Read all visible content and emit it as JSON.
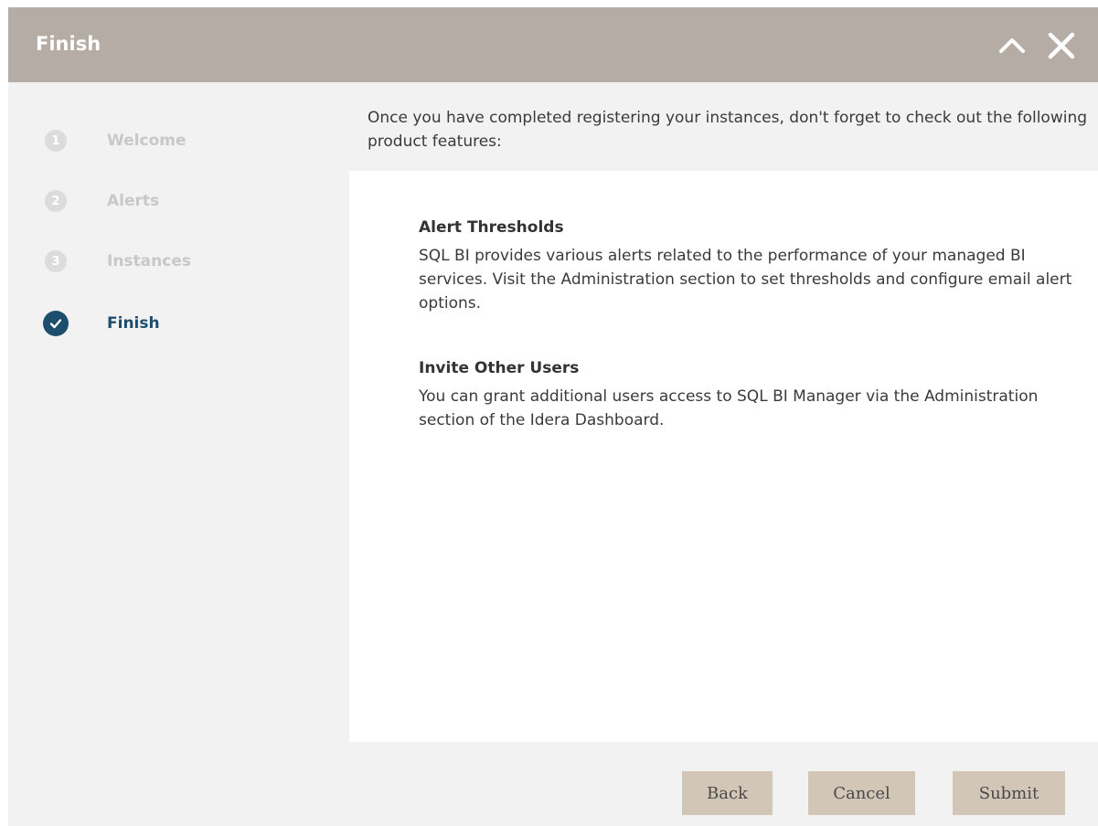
{
  "dialog": {
    "title": "Finish"
  },
  "steps": [
    {
      "number": "1",
      "label": "Welcome",
      "state": "inactive"
    },
    {
      "number": "2",
      "label": "Alerts",
      "state": "inactive"
    },
    {
      "number": "3",
      "label": "Instances",
      "state": "inactive"
    },
    {
      "number": "",
      "label": "Finish",
      "state": "active",
      "icon": "check-circle-icon"
    }
  ],
  "content": {
    "intro": "Once you have completed registering your instances, don't forget to check out the following product features:",
    "features": [
      {
        "heading": "Alert Thresholds",
        "body": "SQL BI provides various alerts related to the performance of your managed BI services. Visit the Administration section to set thresholds and configure email alert options."
      },
      {
        "heading": "Invite Other Users",
        "body": "You can grant additional users access to SQL BI Manager via the Administration section of the Idera Dashboard."
      }
    ]
  },
  "buttons": {
    "back": "Back",
    "cancel": "Cancel",
    "submit": "Submit"
  },
  "colors": {
    "titlebar": "#b6aca6",
    "active_step": "#1e4e6e",
    "button": "#d2c6b6"
  },
  "icons": {
    "collapse": "chevron-up-icon",
    "close": "close-icon"
  }
}
